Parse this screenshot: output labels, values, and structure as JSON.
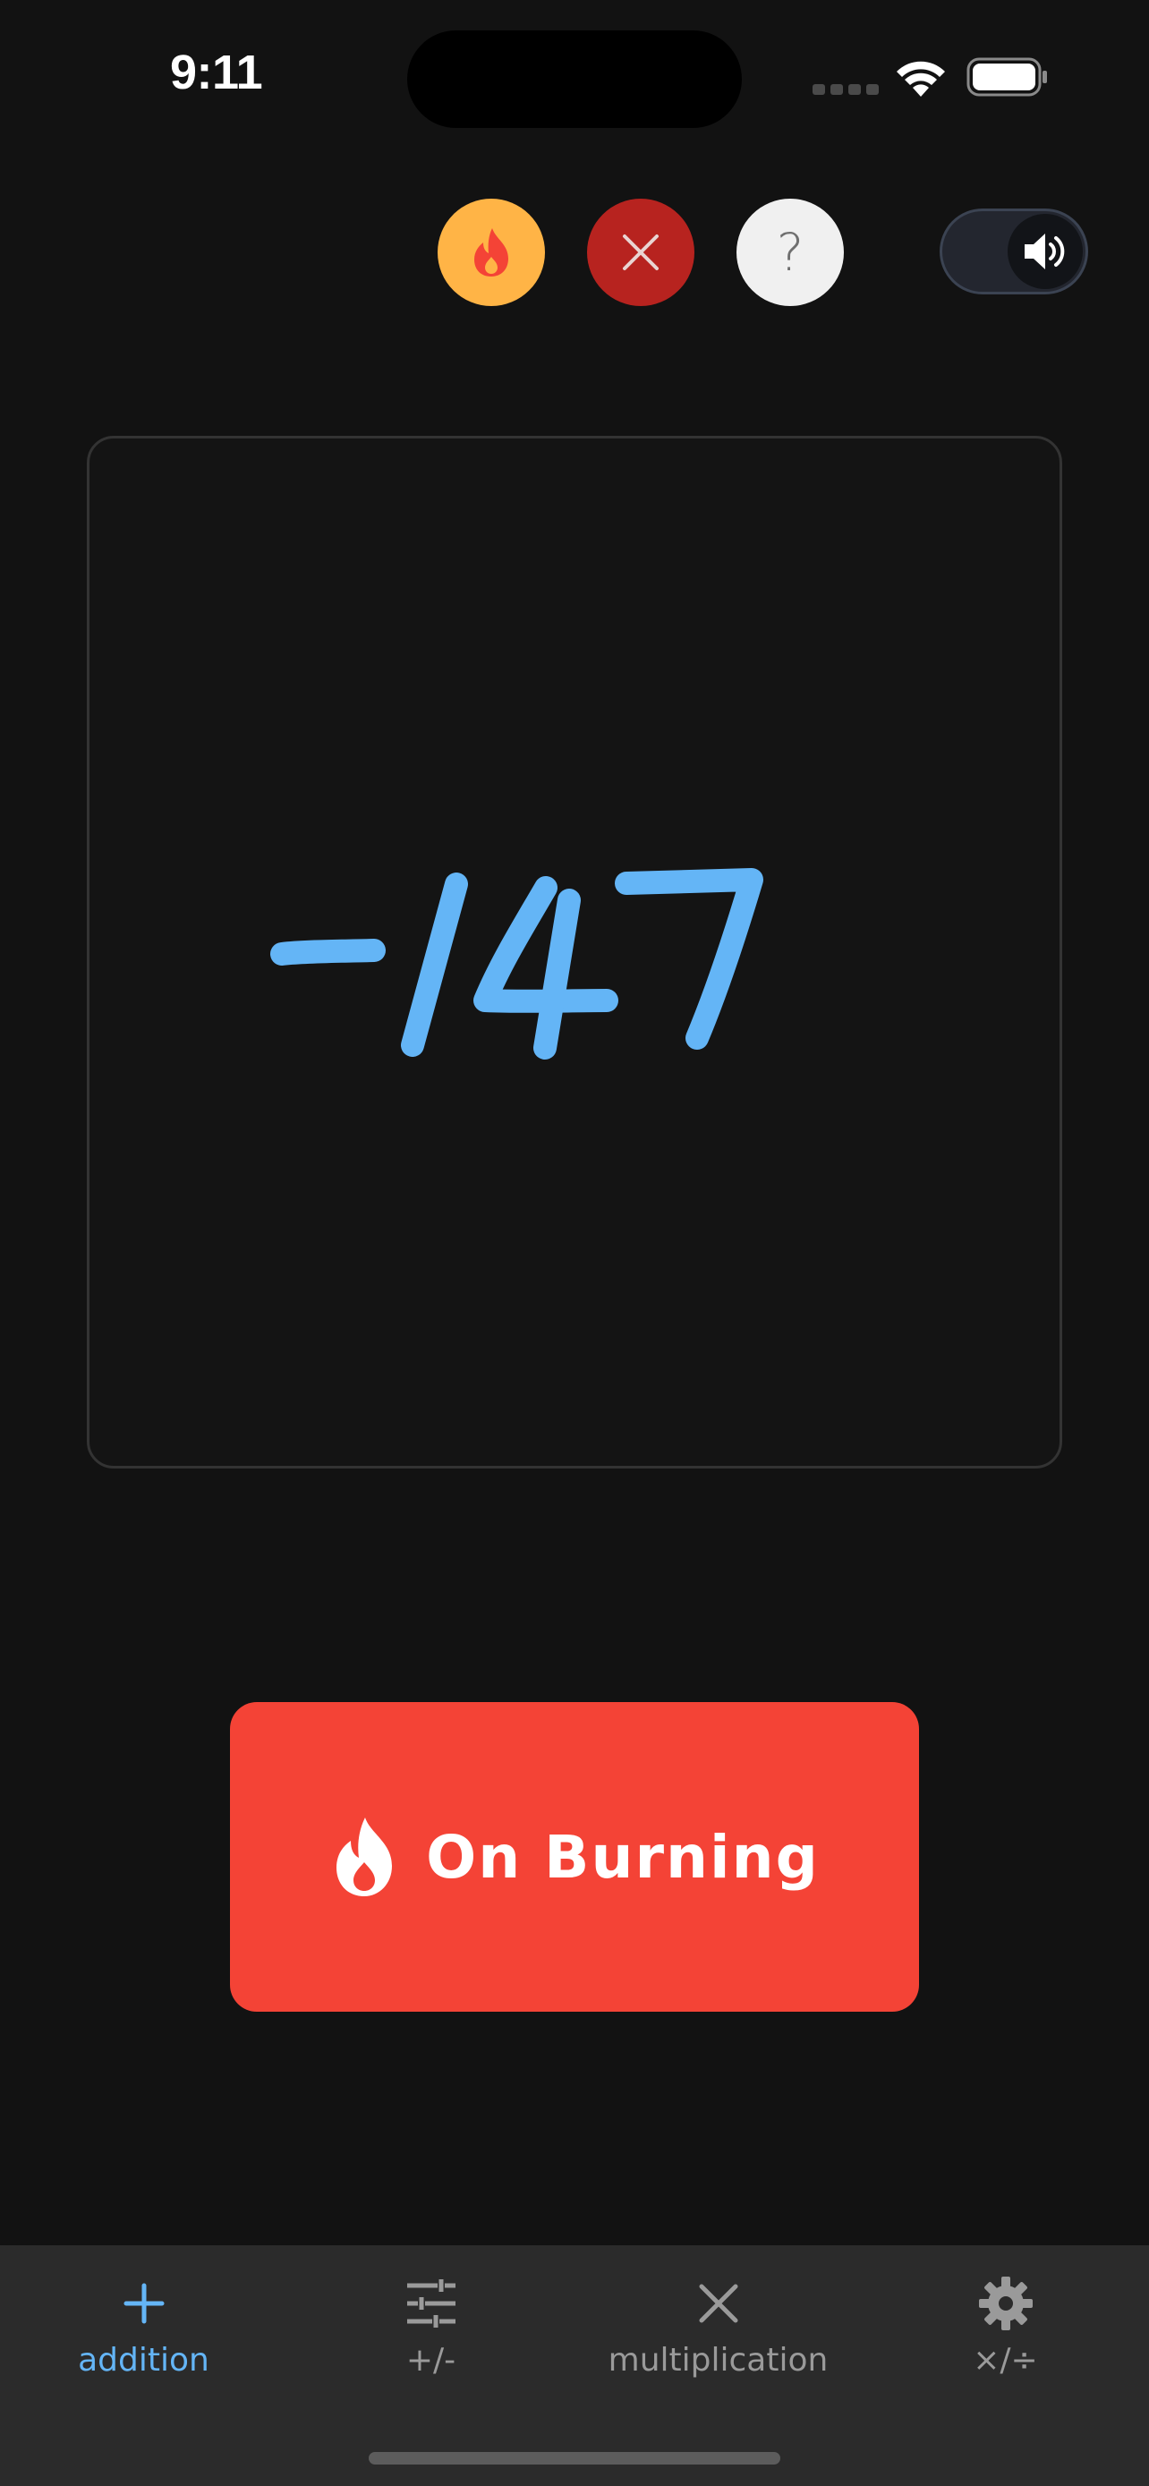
{
  "status_bar": {
    "time": "9:11"
  },
  "toolbar": {
    "streak_icon": "flame-icon",
    "close_icon": "close-icon",
    "help_label": "?",
    "sound_icon": "speaker-icon",
    "sound_enabled": true
  },
  "canvas": {
    "handwritten_answer": "-147"
  },
  "primary_action": {
    "label": "On Burning",
    "icon": "flame-icon"
  },
  "tabs": [
    {
      "label": "addition",
      "icon": "plus-icon",
      "active": true
    },
    {
      "label": "+/-",
      "icon": "sliders-icon",
      "active": false
    },
    {
      "label": "multiplication",
      "icon": "multiply-icon",
      "active": false
    },
    {
      "label": "×/÷",
      "icon": "gear-icon",
      "active": false
    }
  ],
  "colors": {
    "background": "#121212",
    "streak_button": "#ffb446",
    "close_button": "#b7231f",
    "primary_button": "#f44336",
    "ink": "#64b5f6",
    "tab_active": "#64b5f6",
    "tab_inactive": "#9a9a9a"
  }
}
